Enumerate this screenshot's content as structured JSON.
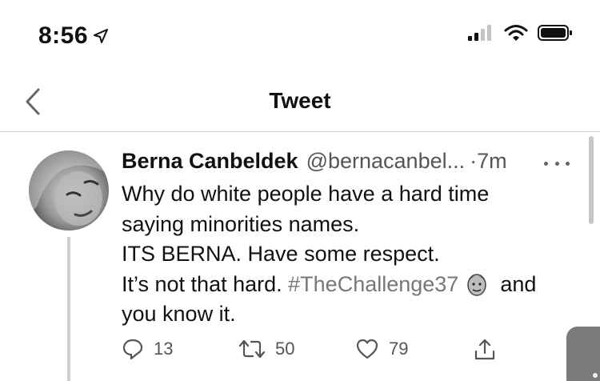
{
  "status_bar": {
    "time": "8:56",
    "icons": [
      "location-arrow-icon",
      "cellular-signal-icon",
      "wifi-icon",
      "battery-icon"
    ]
  },
  "nav": {
    "back_icon": "chevron-left-icon",
    "title": "Tweet"
  },
  "tweet": {
    "author_name": "Berna Canbeldek",
    "author_handle": "@bernacanbel...",
    "separator": "·",
    "time": "7m",
    "body_lines": [
      "Why do white people have a hard time",
      "saying minorities names.",
      "ITS BERNA. Have some respect.",
      "It’s not that hard."
    ],
    "hashtag": "#TheChallenge37",
    "after_emoji": "and",
    "last_line": "you know it.",
    "actions": {
      "reply_count": "13",
      "retweet_count": "50",
      "like_count": "79"
    }
  },
  "colors": {
    "text": "#111111",
    "secondary": "#555555",
    "hashtag": "#777777",
    "divider": "#d8d8d8"
  }
}
